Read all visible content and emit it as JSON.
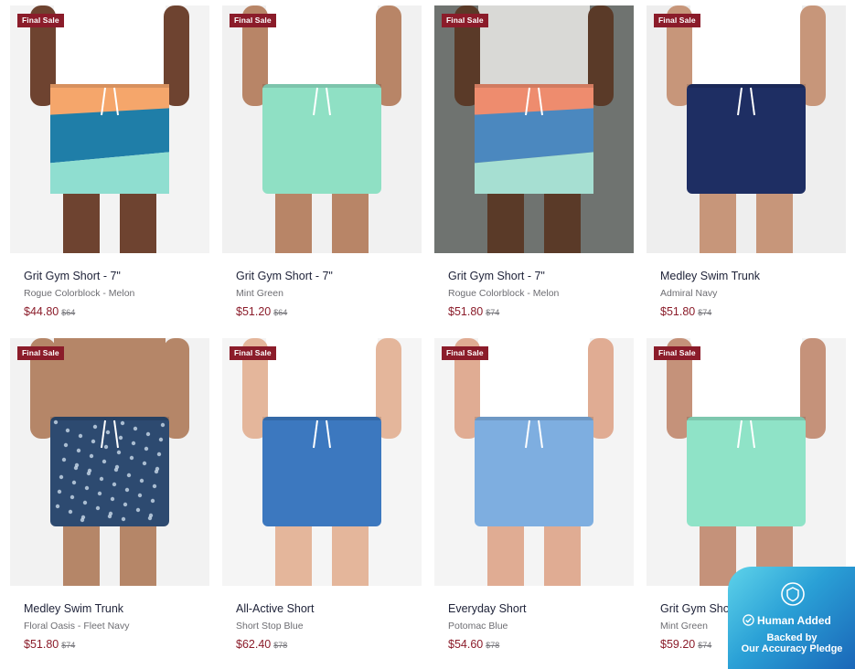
{
  "products": [
    {
      "badge": "Final Sale",
      "title": "Grit Gym Short - 7\"",
      "variant": "Rogue Colorblock - Melon",
      "price": "$44.80",
      "original_price": "$64",
      "colors": {
        "background": "#f3f3f3",
        "skin": "#6e4330",
        "top": "#ffffff",
        "shorts": [
          "#f5a66b",
          "#1f7ea8",
          "#8fded0"
        ]
      }
    },
    {
      "badge": "Final Sale",
      "title": "Grit Gym Short - 7\"",
      "variant": "Mint Green",
      "price": "$51.20",
      "original_price": "$64",
      "colors": {
        "background": "#f1f1f1",
        "skin": "#b88567",
        "top": "#ffffff",
        "shorts": [
          "#8fe0c4"
        ]
      }
    },
    {
      "badge": "Final Sale",
      "title": "Grit Gym Short - 7\"",
      "variant": "Rogue Colorblock - Melon",
      "price": "$51.80",
      "original_price": "$74",
      "colors": {
        "background": "#6f7370",
        "skin": "#5a3a28",
        "top": "#d9d9d6",
        "shorts": [
          "#ee8c6e",
          "#4b88bf",
          "#a6dfd2"
        ]
      }
    },
    {
      "badge": "Final Sale",
      "title": "Medley Swim Trunk",
      "variant": "Admiral Navy",
      "price": "$51.80",
      "original_price": "$74",
      "colors": {
        "background": "#eeeeee",
        "skin": "#c7967a",
        "top": "#ffffff",
        "shorts": [
          "#1e2e63"
        ]
      }
    },
    {
      "badge": "Final Sale",
      "title": "Medley Swim Trunk",
      "variant": "Floral Oasis - Fleet Navy",
      "price": "$51.80",
      "original_price": "$74",
      "colors": {
        "background": "#f2f2f2",
        "skin": "#b58668",
        "top": "#b58668",
        "shorts": [
          "#2d4a70"
        ]
      }
    },
    {
      "badge": "Final Sale",
      "title": "All-Active Short",
      "variant": "Short Stop Blue",
      "price": "$62.40",
      "original_price": "$78",
      "colors": {
        "background": "#f5f5f5",
        "skin": "#e4b69b",
        "top": "#ffffff",
        "shorts": [
          "#3c78bf"
        ]
      }
    },
    {
      "badge": "Final Sale",
      "title": "Everyday Short",
      "variant": "Potomac Blue",
      "price": "$54.60",
      "original_price": "$78",
      "colors": {
        "background": "#f4f4f4",
        "skin": "#e0ac93",
        "top": "#ffffff",
        "shorts": [
          "#7eaee0"
        ]
      }
    },
    {
      "badge": "Final Sale",
      "title": "Grit Gym Short - 7\"",
      "variant": "Mint Green",
      "price": "$59.20",
      "original_price": "$74",
      "colors": {
        "background": "#f3f3f3",
        "skin": "#c5927a",
        "top": "#ffffff",
        "shorts": [
          "#8fe3c7"
        ]
      }
    }
  ],
  "pledge": {
    "line1": "Human Added",
    "line2": "Backed by",
    "line3": "Our Accuracy Pledge",
    "icons": [
      "shield-badge-icon",
      "check-circle-icon"
    ]
  },
  "theme": {
    "sale_red": "#8b1c2a",
    "title_color": "#20243a",
    "muted_text": "#6d6d72"
  }
}
